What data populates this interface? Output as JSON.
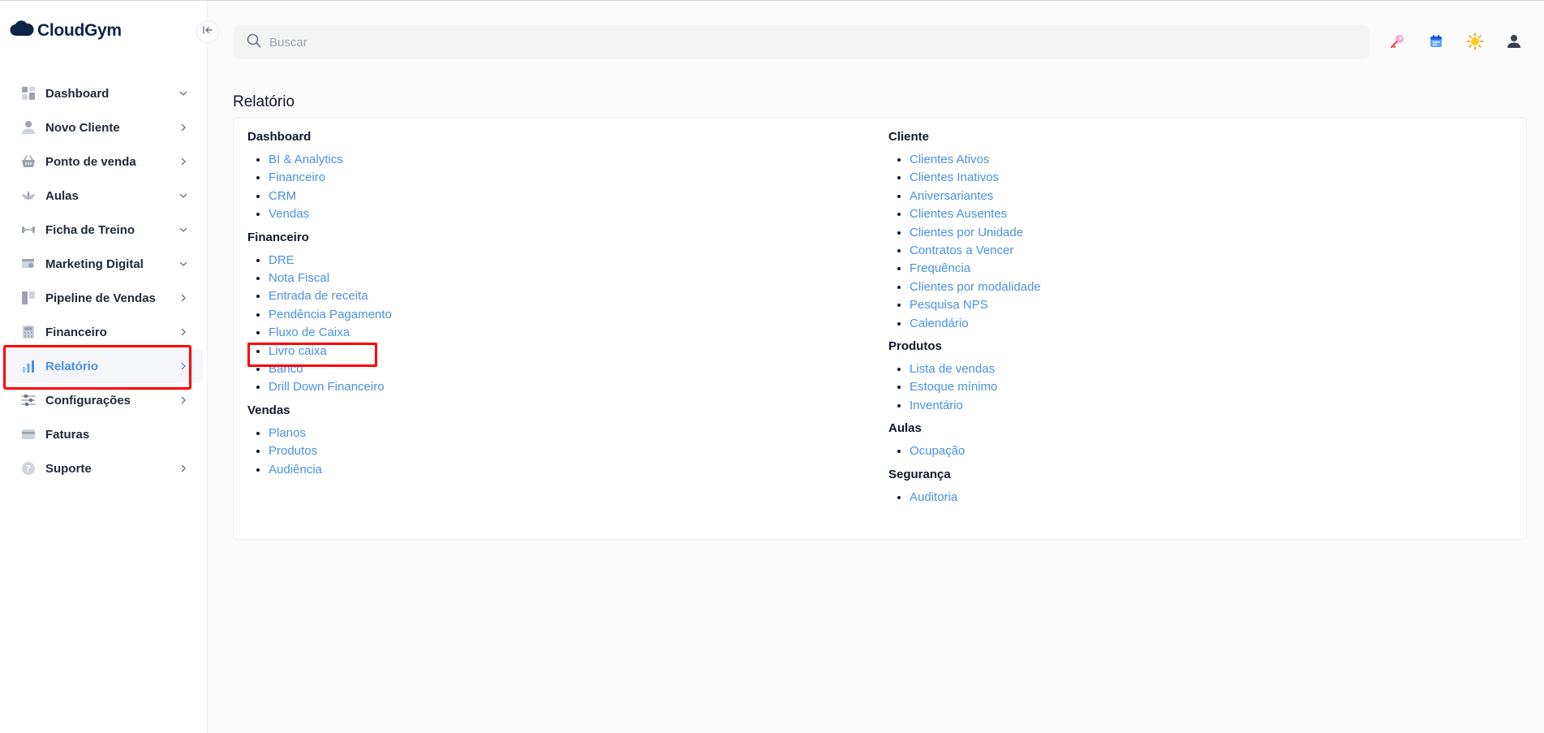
{
  "brand": {
    "name": "CloudGym"
  },
  "sidebar": {
    "items": [
      {
        "label": "Dashboard",
        "icon": "dashboard-icon",
        "chevron": "down"
      },
      {
        "label": "Novo Cliente",
        "icon": "user-icon",
        "chevron": "right"
      },
      {
        "label": "Ponto de venda",
        "icon": "basket-icon",
        "chevron": "right"
      },
      {
        "label": "Aulas",
        "icon": "lotus-icon",
        "chevron": "down"
      },
      {
        "label": "Ficha de Treino",
        "icon": "dumbbell-icon",
        "chevron": "down"
      },
      {
        "label": "Marketing Digital",
        "icon": "megaphone-icon",
        "chevron": "down"
      },
      {
        "label": "Pipeline de Vendas",
        "icon": "kanban-icon",
        "chevron": "right"
      },
      {
        "label": "Financeiro",
        "icon": "calculator-icon",
        "chevron": "right"
      },
      {
        "label": "Relatório",
        "icon": "bar-chart-icon",
        "chevron": "right",
        "active": true
      },
      {
        "label": "Configurações",
        "icon": "sliders-icon",
        "chevron": "right"
      },
      {
        "label": "Faturas",
        "icon": "credit-card-icon",
        "chevron": "none"
      },
      {
        "label": "Suporte",
        "icon": "help-icon",
        "chevron": "right"
      }
    ]
  },
  "search": {
    "placeholder": "Buscar"
  },
  "header_icons": [
    "key-icon",
    "calendar-icon",
    "sun-icon",
    "profile-icon"
  ],
  "page": {
    "title": "Relatório"
  },
  "reports": {
    "left": [
      {
        "title": "Dashboard",
        "links": [
          "BI & Analytics",
          "Financeiro",
          "CRM",
          "Vendas"
        ]
      },
      {
        "title": "Financeiro",
        "links": [
          "DRE",
          "Nota Fiscal",
          "Entrada de receita",
          "Pendência Pagamento",
          "Fluxo de Caixa",
          "Livro caixa",
          "Banco",
          "Drill Down Financeiro"
        ]
      },
      {
        "title": "Vendas",
        "links": [
          "Planos",
          "Produtos",
          "Audiência"
        ]
      }
    ],
    "right": [
      {
        "title": "Cliente",
        "links": [
          "Clientes Ativos",
          "Clientes Inativos",
          "Aniversariantes",
          "Clientes Ausentes",
          "Clientes por Unidade",
          "Contratos a Vencer",
          "Frequência",
          "Clientes por modalidade",
          "Pesquisa NPS",
          "Calendário"
        ]
      },
      {
        "title": "Produtos",
        "links": [
          "Lista de vendas",
          "Estoque mínimo",
          "Inventário"
        ]
      },
      {
        "title": "Aulas",
        "links": [
          "Ocupação"
        ]
      },
      {
        "title": "Segurança",
        "links": [
          "Auditoria"
        ]
      }
    ]
  },
  "colors": {
    "accent": "#4a90e2",
    "brand": "#0f2347",
    "highlight": "#ff0000"
  }
}
